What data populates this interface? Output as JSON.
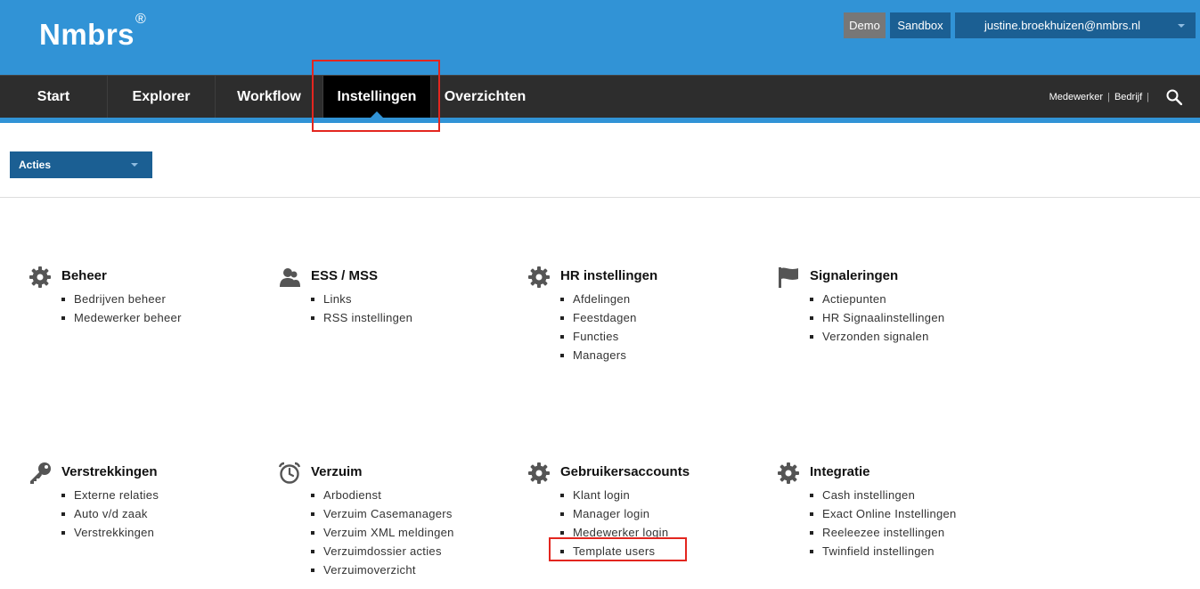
{
  "header": {
    "logo": "Nmbrs",
    "logo_mark": "®",
    "demo_label": "Demo",
    "sandbox_label": "Sandbox",
    "user_email": "justine.broekhuizen@nmbrs.nl"
  },
  "nav": {
    "items": [
      "Start",
      "Explorer",
      "Workflow",
      "Instellingen",
      "Overzichten"
    ],
    "active": "Instellingen",
    "right_links": [
      "Medewerker",
      "Bedrijf"
    ],
    "separator": "|"
  },
  "acties": {
    "label": "Acties"
  },
  "sections": [
    {
      "title": "Beheer",
      "icon": "gear-icon",
      "items": [
        "Bedrijven beheer",
        "Medewerker beheer"
      ]
    },
    {
      "title": "ESS / MSS",
      "icon": "users-icon",
      "items": [
        "Links",
        "RSS instellingen"
      ]
    },
    {
      "title": "HR instellingen",
      "icon": "gear-icon",
      "items": [
        "Afdelingen",
        "Feestdagen",
        "Functies",
        "Managers"
      ]
    },
    {
      "title": "Signaleringen",
      "icon": "flag-icon",
      "items": [
        "Actiepunten",
        "HR Signaalinstellingen",
        "Verzonden signalen"
      ]
    },
    {
      "title": "Verstrekkingen",
      "icon": "key-icon",
      "items": [
        "Externe relaties",
        "Auto v/d zaak",
        "Verstrekkingen"
      ]
    },
    {
      "title": "Verzuim",
      "icon": "alarm-clock-icon",
      "items": [
        "Arbodienst",
        "Verzuim Casemanagers",
        "Verzuim XML meldingen",
        "Verzuimdossier acties",
        "Verzuimoverzicht"
      ]
    },
    {
      "title": "Gebruikersaccounts",
      "icon": "gear-icon",
      "items": [
        "Klant login",
        "Manager login",
        "Medewerker login",
        "Template users"
      ]
    },
    {
      "title": "Integratie",
      "icon": "gear-icon",
      "items": [
        "Cash instellingen",
        "Exact Online Instellingen",
        "Reeleezee instellingen",
        "Twinfield instellingen"
      ]
    }
  ],
  "colors": {
    "header_blue": "#3193d6",
    "dark_blue": "#1b5f93",
    "nav_dark": "#2d2d2d",
    "highlight_red": "#e3261f"
  }
}
